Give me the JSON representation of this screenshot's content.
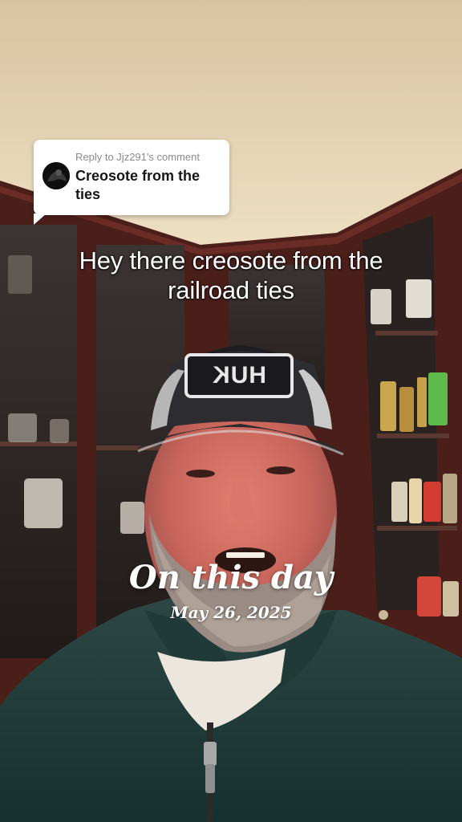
{
  "reply": {
    "meta": "Reply to Jjz291's comment",
    "text": "Creosote from the ties"
  },
  "caption": {
    "line1": "Hey there creosote from the",
    "line2": "railroad ties"
  },
  "cap_logo": {
    "text": "HUK"
  },
  "memory": {
    "title": "On this day",
    "date": "May 26, 2025"
  }
}
